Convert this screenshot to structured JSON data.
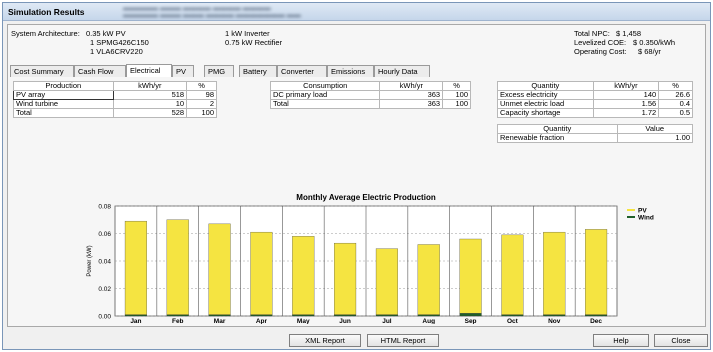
{
  "window": {
    "title": "Simulation Results"
  },
  "system": {
    "label": "System Architecture:",
    "lines_left": [
      "0.35 kW PV",
      "1 SPMG426C150",
      "1 VLA6CRV220"
    ],
    "lines_right": [
      "1 kW Inverter",
      "0.75 kW Rectifier"
    ]
  },
  "costs": {
    "npc_label": "Total NPC:",
    "npc_value": "$ 1,458",
    "coe_label": "Levelized COE:",
    "coe_value": "$ 0.350/kWh",
    "op_label": "Operating Cost:",
    "op_value": "$ 68/yr"
  },
  "tabs": [
    "Cost Summary",
    "Cash Flow",
    "Electrical",
    "PV",
    "PMG",
    "Battery",
    "Converter",
    "Emissions",
    "Hourly Data"
  ],
  "production": {
    "headers": [
      "Production",
      "kWh/yr",
      "%"
    ],
    "rows": [
      [
        "PV array",
        "518",
        "98"
      ],
      [
        "Wind turbine",
        "10",
        "2"
      ],
      [
        "Total",
        "528",
        "100"
      ]
    ]
  },
  "consumption": {
    "headers": [
      "Consumption",
      "kWh/yr",
      "%"
    ],
    "rows": [
      [
        "DC primary load",
        "363",
        "100"
      ],
      [
        "Total",
        "363",
        "100"
      ]
    ]
  },
  "quantity": {
    "headers": [
      "Quantity",
      "kWh/yr",
      "%"
    ],
    "rows": [
      [
        "Excess electricity",
        "140",
        "26.6"
      ],
      [
        "Unmet electric load",
        "1.56",
        "0.4"
      ],
      [
        "Capacity shortage",
        "1.72",
        "0.5"
      ]
    ]
  },
  "quantity2": {
    "headers": [
      "Quantity",
      "Value"
    ],
    "rows": [
      [
        "Renewable fraction",
        "1.00"
      ]
    ]
  },
  "chart_data": {
    "type": "bar",
    "title": "Monthly Average Electric Production",
    "ylabel": "Power (kW)",
    "xlabel": "",
    "categories": [
      "Jan",
      "Feb",
      "Mar",
      "Apr",
      "May",
      "Jun",
      "Jul",
      "Aug",
      "Sep",
      "Oct",
      "Nov",
      "Dec"
    ],
    "ylim": [
      0,
      0.08
    ],
    "yticks": [
      "0.00",
      "0.02",
      "0.04",
      "0.06",
      "0.08"
    ],
    "stacked": true,
    "legend_position": "right",
    "series": [
      {
        "name": "PV",
        "color": "#f5e441",
        "values": [
          0.068,
          0.069,
          0.066,
          0.06,
          0.057,
          0.052,
          0.048,
          0.051,
          0.054,
          0.058,
          0.06,
          0.062
        ]
      },
      {
        "name": "Wind",
        "color": "#1f5f2a",
        "values": [
          0.001,
          0.001,
          0.001,
          0.001,
          0.001,
          0.001,
          0.001,
          0.001,
          0.002,
          0.001,
          0.001,
          0.001
        ]
      }
    ]
  },
  "buttons": {
    "xml": "XML Report",
    "html": "HTML Report",
    "help": "Help",
    "close": "Close"
  }
}
